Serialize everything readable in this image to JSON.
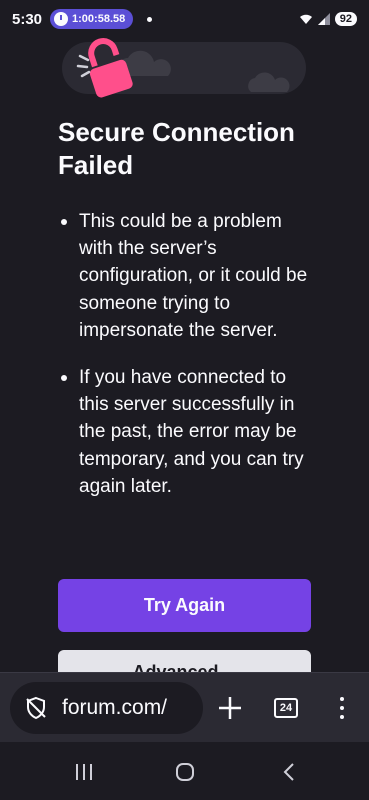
{
  "status": {
    "time": "5:30",
    "timer": "1:00:58.58",
    "battery": "92"
  },
  "error_page": {
    "title": "Secure Connection Failed",
    "bullets": [
      "This could be a problem with the server’s configuration, or it could be someone trying to impersonate the server.",
      "If you have connected to this server successfully in the past, the error may be temporary, and you can try again later."
    ],
    "primary_button": "Try Again",
    "secondary_button": "Advanced…"
  },
  "toolbar": {
    "url": "forum.com/",
    "tab_count": "24"
  },
  "icons": {
    "lock": "broken-lock-icon",
    "shield": "shield-off-icon",
    "new_tab": "plus-icon",
    "menu": "more-vertical-icon"
  },
  "colors": {
    "background": "#1c1b22",
    "primary": "#7542e5",
    "lock": "#ff4f8b"
  }
}
